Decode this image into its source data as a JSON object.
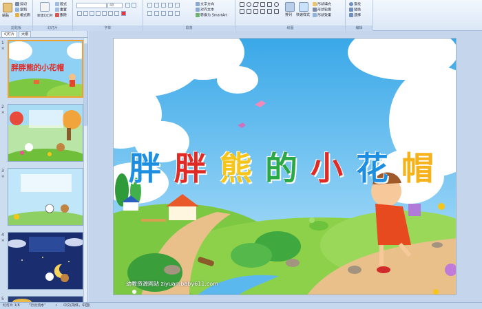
{
  "ribbon": {
    "groups": [
      {
        "label": "剪贴板",
        "buttons": [
          "剪切",
          "复制",
          "格式刷"
        ],
        "big": "粘贴"
      },
      {
        "label": "幻灯片",
        "buttons": [
          "版式",
          "重置",
          "删除"
        ],
        "big": "新建幻灯片"
      },
      {
        "label": "字体",
        "font_size": "48"
      },
      {
        "label": "段落",
        "buttons": [
          "文字方向",
          "对齐文本",
          "转换为 SmartArt"
        ]
      },
      {
        "label": "绘图",
        "buttons": [
          "形状填充",
          "形状轮廓",
          "形状效果"
        ],
        "arrange": "排列",
        "quick": "快速样式"
      },
      {
        "label": "编辑",
        "buttons": [
          "查找",
          "替换",
          "选择"
        ]
      }
    ]
  },
  "panel": {
    "tabs": [
      "幻灯片",
      "大纲"
    ],
    "thumbs": [
      {
        "num": "1",
        "title": "胖胖熊的小花帽"
      },
      {
        "num": "2"
      },
      {
        "num": "3"
      },
      {
        "num": "4"
      },
      {
        "num": "5"
      }
    ]
  },
  "slide": {
    "title_chars": [
      {
        "char": "胖",
        "color": "#1e8fe0"
      },
      {
        "char": "胖",
        "color": "#e02a25"
      },
      {
        "char": "熊",
        "color": "#f6c51a"
      },
      {
        "char": "的",
        "color": "#2aa846"
      },
      {
        "char": "小",
        "color": "#e02a25"
      },
      {
        "char": "花",
        "color": "#1e8fe0"
      },
      {
        "char": "帽",
        "color": "#f6b21a"
      }
    ],
    "watermark": "幼教资源网站  ziyuan.baby611.com"
  },
  "status": {
    "slide_info": "幻灯片 1/8",
    "theme": "\"行云流水\"",
    "language": "中文(简体，中国)"
  }
}
